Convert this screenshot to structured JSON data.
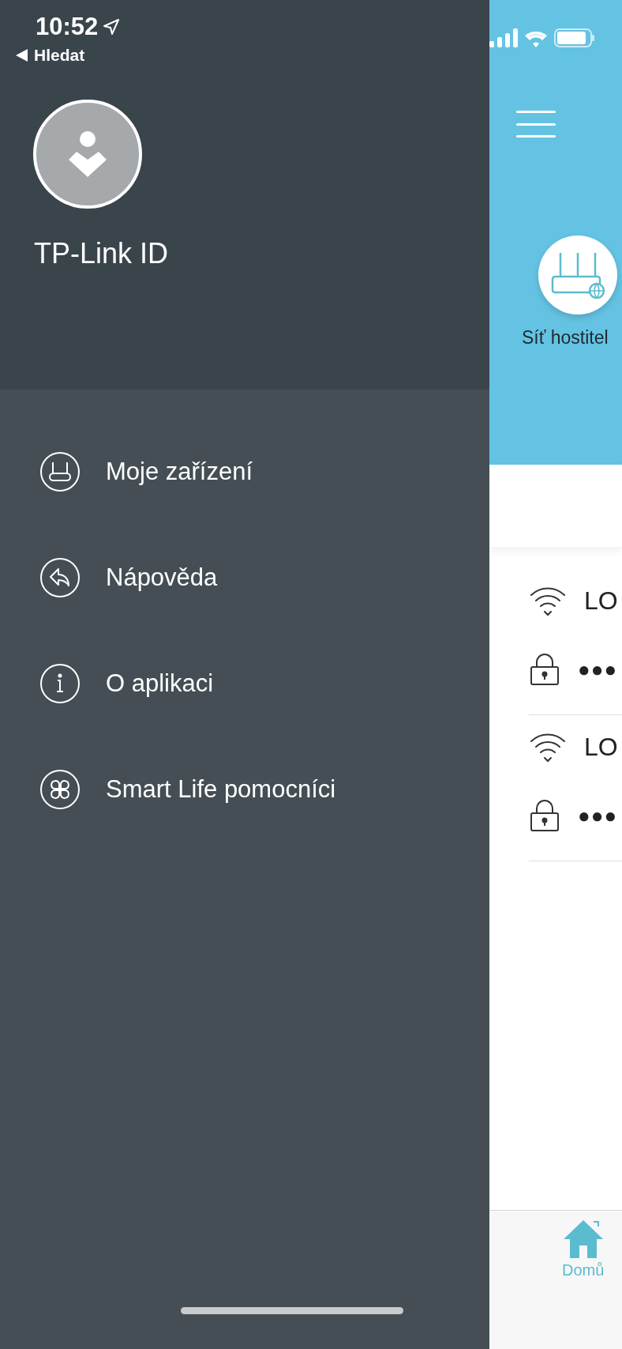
{
  "status_bar": {
    "time": "10:52",
    "back_label": "Hledat"
  },
  "drawer": {
    "account_label": "TP-Link ID",
    "menu": [
      {
        "label": "Moje zařízení",
        "kind": "router"
      },
      {
        "label": "Nápověda",
        "kind": "reply"
      },
      {
        "label": "O aplikaci",
        "kind": "info"
      },
      {
        "label": "Smart Life pomocníci",
        "kind": "clover"
      }
    ]
  },
  "main": {
    "network_label": "Síť hostitel",
    "networks": [
      {
        "name": "LO",
        "password": "●●●"
      },
      {
        "name": "LO",
        "password": "●●●"
      }
    ]
  },
  "tab_bar": {
    "tabs": [
      {
        "label": "Domů",
        "selected": true
      }
    ]
  }
}
